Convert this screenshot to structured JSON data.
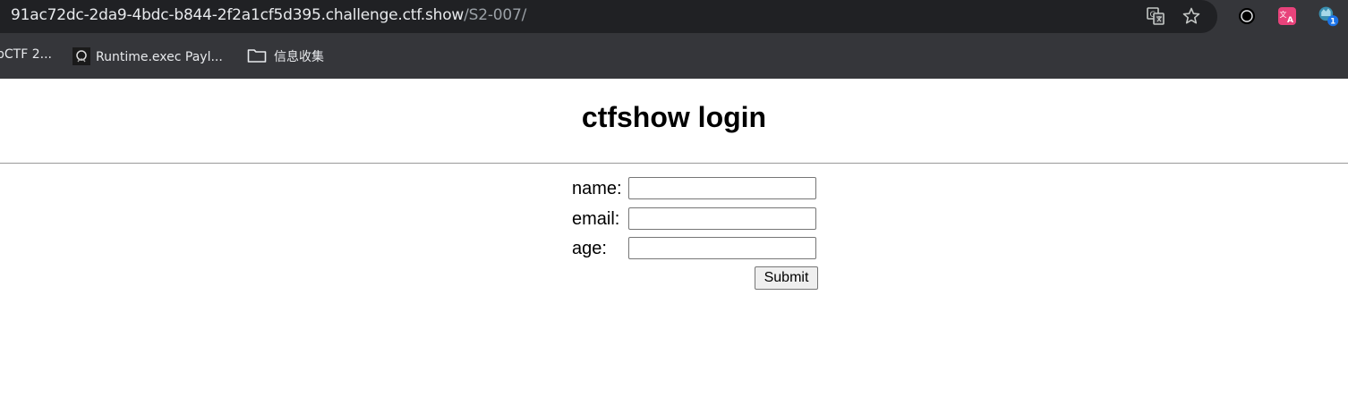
{
  "browser": {
    "url_host": "91ac72dc-2da9-4bdc-b844-2f2a1cf5d395.challenge.ctf.show",
    "url_path": "/S2-007/",
    "icons": [
      "translate-icon",
      "star-icon",
      "extension-circle-icon",
      "extension-translate-icon",
      "extension-badge-icon"
    ],
    "extension_badge": "1"
  },
  "bookmarks": [
    {
      "label": "pCTF 2..."
    },
    {
      "label": "Runtime.exec Payl..."
    },
    {
      "label": "信息收集"
    }
  ],
  "page": {
    "title": "ctfshow login",
    "fields": [
      {
        "label": "name:",
        "value": ""
      },
      {
        "label": "email:",
        "value": ""
      },
      {
        "label": "age:",
        "value": ""
      }
    ],
    "submit_label": "Submit"
  },
  "colors": {
    "chrome_bg": "#35363a",
    "omnibox_bg": "#202124",
    "page_bg": "#ffffff"
  }
}
